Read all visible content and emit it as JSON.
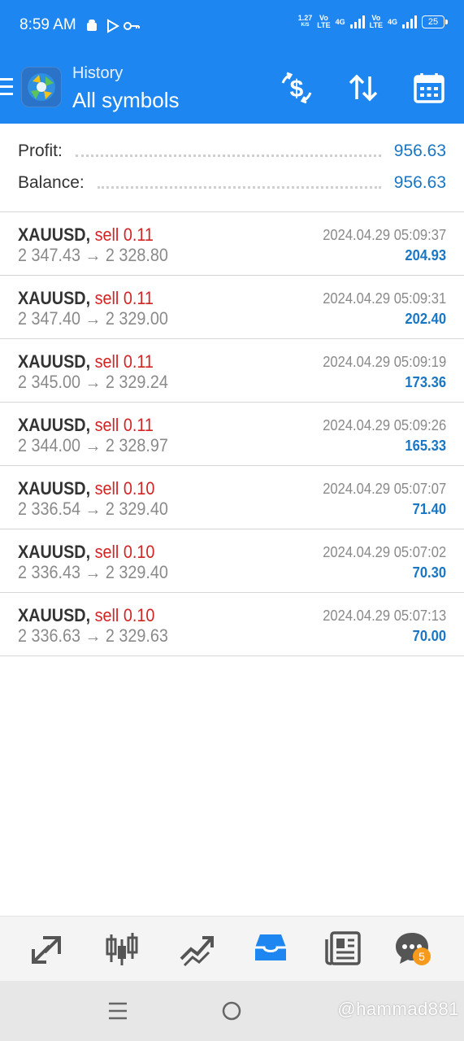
{
  "status_bar": {
    "time": "8:59 AM",
    "net_speed": "1.27",
    "net_unit": "K/S",
    "volte1": "Vo\nLTE",
    "net1": "4G",
    "volte2": "Vo\nLTE",
    "net2": "4G",
    "battery": "25"
  },
  "header": {
    "subtitle": "History",
    "title": "All symbols",
    "icons": [
      "menu-icon",
      "app-logo",
      "dollar-exchange-icon",
      "sort-icon",
      "calendar-icon"
    ],
    "color": "#1e86f0"
  },
  "summary": {
    "profit_label": "Profit:",
    "profit_value": "956.63",
    "balance_label": "Balance:",
    "balance_value": "956.63"
  },
  "deals": [
    {
      "symbol": "XAUUSD,",
      "type": "sell 0.11",
      "prices": "2 347.43 → 2 328.80",
      "time": "2024.04.29 05:09:37",
      "profit": "204.93"
    },
    {
      "symbol": "XAUUSD,",
      "type": "sell 0.11",
      "prices": "2 347.40 → 2 329.00",
      "time": "2024.04.29 05:09:31",
      "profit": "202.40"
    },
    {
      "symbol": "XAUUSD,",
      "type": "sell 0.11",
      "prices": "2 345.00 → 2 329.24",
      "time": "2024.04.29 05:09:19",
      "profit": "173.36"
    },
    {
      "symbol": "XAUUSD,",
      "type": "sell 0.11",
      "prices": "2 344.00 → 2 328.97",
      "time": "2024.04.29 05:09:26",
      "profit": "165.33"
    },
    {
      "symbol": "XAUUSD,",
      "type": "sell 0.10",
      "prices": "2 336.54 → 2 329.40",
      "time": "2024.04.29 05:07:07",
      "profit": "71.40"
    },
    {
      "symbol": "XAUUSD,",
      "type": "sell 0.10",
      "prices": "2 336.43 → 2 329.40",
      "time": "2024.04.29 05:07:02",
      "profit": "70.30"
    },
    {
      "symbol": "XAUUSD,",
      "type": "sell 0.10",
      "prices": "2 336.63 → 2 329.63",
      "time": "2024.04.29 05:07:13",
      "profit": "70.00"
    }
  ],
  "bottom_nav": {
    "items": [
      "quotes-icon",
      "chart-icon",
      "trade-icon",
      "history-icon",
      "news-icon",
      "chat-icon"
    ],
    "active": "history-icon",
    "chat_badge": "5",
    "active_color": "#1e86f0",
    "inactive_color": "#555555"
  },
  "watermark": "@hammad881",
  "colors": {
    "accent": "#1e86f0",
    "sell": "#d32424",
    "profit": "#1976c4"
  }
}
